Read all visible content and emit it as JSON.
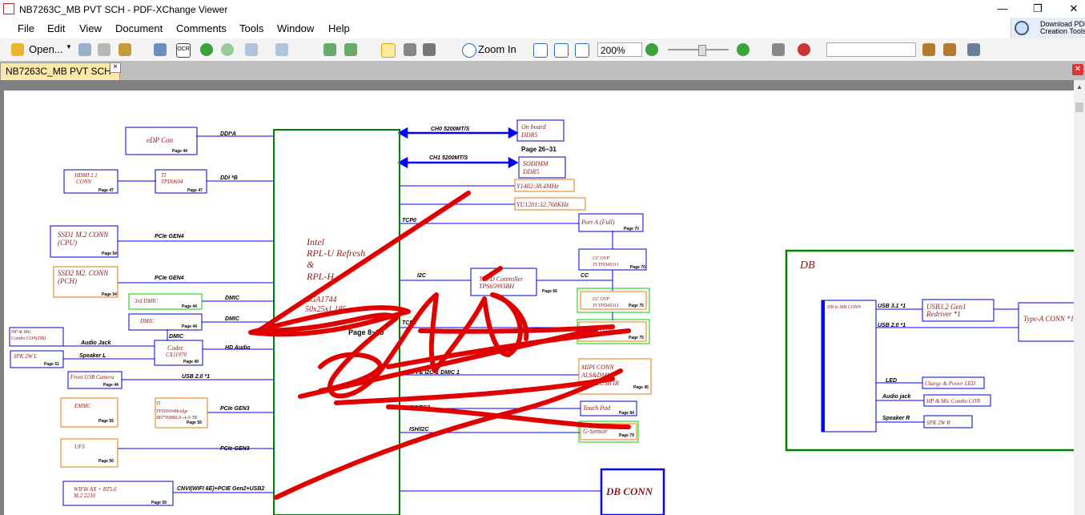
{
  "window": {
    "title": "NB7263C_MB PVT SCH - PDF-XChange Viewer",
    "minimize": "—",
    "restore": "❐",
    "close": "✕"
  },
  "menu": [
    "File",
    "Edit",
    "View",
    "Document",
    "Comments",
    "Tools",
    "Window",
    "Help"
  ],
  "download": {
    "label": "Download PDF\nCreation Tools"
  },
  "toolbar": {
    "open_label": "Open...",
    "zoom_in_label": "Zoom In",
    "zoom_value": "200%",
    "search_placeholder": ""
  },
  "tab": {
    "label": "NB7263C_MB PVT SCH",
    "close": "×"
  },
  "schematic": {
    "cpu": {
      "line1": "Intel",
      "line2": "RPL-U Refresh",
      "line3": "&",
      "line4": "RPL-H",
      "line5": "BGA1744",
      "line6": "50x25x1.185",
      "page": "Page 8~25"
    },
    "edp": {
      "label": "eDP Con",
      "page": "Page 44",
      "signal": "DDI*A"
    },
    "hdmi": {
      "label1": "HDMI 2.1",
      "label2": "CONN",
      "page": "Page 47"
    },
    "ti604": {
      "label1": "TI",
      "label2": "TPD0604",
      "page": "Page 47",
      "signal": "DDI *B"
    },
    "ssd1": {
      "label1": "SSD1 M.2 CONN",
      "label2": "(CPU)",
      "page": "Page 54",
      "signal": "PCIe GEN4"
    },
    "ssd2": {
      "label1": "SSD2 M2. CONN",
      "label2": "(PCH)",
      "page": "Page 54",
      "signal": "PCIe GEN4"
    },
    "dmic3": {
      "label": "3rd DMIC",
      "page": "Page 44",
      "signal": "DMIC"
    },
    "dmic": {
      "label": "DMIC",
      "page": "Page 44",
      "signal": "DMIC"
    },
    "hpmic": {
      "label1": "HP & Mic",
      "label2": "Combo CON(DB)",
      "signal": "Audio Jack"
    },
    "codec": {
      "label1": "Codec",
      "label2": "CX11970",
      "page": "Page 49",
      "signal": "HD Audio",
      "dmic": "DMIC"
    },
    "spk": {
      "label": "SPK 2W L",
      "page": "Page 51",
      "signal": "Speaker L"
    },
    "cam": {
      "label": "Front USB Camera",
      "page": "Page 44",
      "signal": "USB 2.0 *1"
    },
    "emmc": {
      "label": "EMMC",
      "page": "Page 55"
    },
    "bridge": {
      "label1": "TI",
      "label2": "TPD0604Bridge",
      "label3": "BH799BBLN-A-0-TR",
      "page": "Page 55",
      "signal": "PCIe GEN3"
    },
    "ufs": {
      "label": "UFS",
      "page": "Page 56",
      "signal": "PCIe GEN3"
    },
    "wifi": {
      "label1": "WIFI6 AX + BT5.0",
      "label2": "M.2 2230",
      "page": "Page 59",
      "signal": "CNVI(WIFI 6E)+PCIE Gen2+USB2"
    },
    "ddr_onboard": {
      "label1": "On board",
      "label2": "DDR5",
      "signal": "CH0 5200MT/S",
      "page": "Page 26~31"
    },
    "sodimm": {
      "label1": "SODIMM",
      "label2": "DDR5",
      "signal": "CH1 5200MT/S"
    },
    "xtal1": {
      "label": "Y1402:38.4MHz"
    },
    "xtal2": {
      "label": "YU1201:32.768KHz"
    },
    "porta": {
      "label": "Port A (Full)",
      "page": "Page 70",
      "signal": "TCP0"
    },
    "ccovp1": {
      "label1": "CC OVP",
      "label2": "TI TPD4S311",
      "page": "Page 70"
    },
    "pd": {
      "label": "TI PD Controller",
      "label2": "TPS65993BH",
      "page": "Page 66",
      "signal": "I2C",
      "cc": "CC"
    },
    "ccovp2": {
      "label1": "CC OVP",
      "label2": "TI TPD4S311",
      "page": "Page 75"
    },
    "portb": {
      "label": "Port B (Full)",
      "page": "Page 75",
      "signal": "TCP2"
    },
    "mipi": {
      "label1": "MIPI CONN",
      "label2": "ALS&DMIC",
      "label3": "HPD&USB IR",
      "page": "Page 45",
      "signal": "MIPI & I2C & DMIC 1"
    },
    "touchpad": {
      "label": "Touch Pad",
      "page": "Page 84",
      "signal": "I2C/PS2"
    },
    "gsensor": {
      "label": "G-Sensor",
      "page": "Page 79",
      "signal": "ISH/I2C"
    },
    "dbconn": {
      "label": "DB CONN"
    },
    "db": {
      "title": "DB",
      "conn": "DB to MB CONN",
      "usb31": "USB 3.1 *1",
      "usb20": "USB 2.0 *1",
      "redriver1": "USB3.2 Gen1",
      "redriver2": "Redriver *1",
      "typea": "Type-A CONN *1",
      "led_sig": "LED",
      "led": "Charge & Power LED",
      "aj_sig": "Audio jack",
      "aj": "HP & Mic Combo CON",
      "spk_sig": "Speaker R",
      "spk": "SPK 2W R"
    },
    "annotation_color": "#e00000"
  }
}
